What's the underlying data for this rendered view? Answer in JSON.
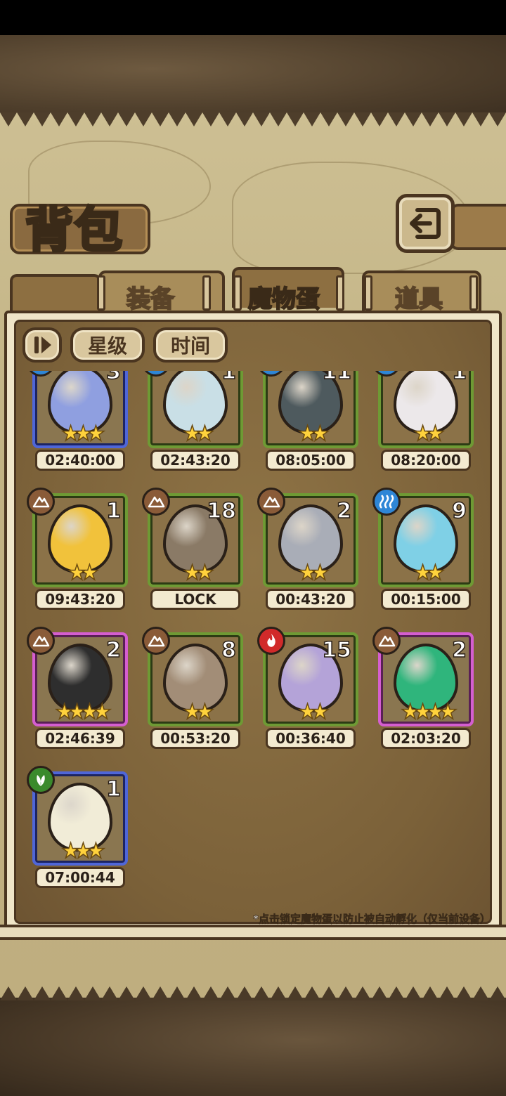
{
  "header": {
    "title": "背包",
    "back_button_icon": "return-arrow-icon"
  },
  "tabs": [
    {
      "label": "装备",
      "active": false
    },
    {
      "label": "魔物蛋",
      "active": true
    },
    {
      "label": "道具",
      "active": false
    }
  ],
  "sort": {
    "toggle_icon": "sort-toggle-icon",
    "star_label": "星级",
    "time_label": "时间"
  },
  "eggs": [
    {
      "count": "3",
      "stars": "★★★",
      "timer": "02:40:00",
      "rarity": "blue",
      "element": "water",
      "color": "#8f9fe0"
    },
    {
      "count": "1",
      "stars": "★★",
      "timer": "02:43:20",
      "rarity": "green",
      "element": "water",
      "color": "#c9dfe6"
    },
    {
      "count": "11",
      "stars": "★★",
      "timer": "08:05:00",
      "rarity": "green",
      "element": "water",
      "color": "#4e5a5e"
    },
    {
      "count": "1",
      "stars": "★★",
      "timer": "08:20:00",
      "rarity": "green",
      "element": "water",
      "color": "#ece8ea"
    },
    {
      "count": "1",
      "stars": "★★",
      "timer": "09:43:20",
      "rarity": "green",
      "element": "earth",
      "color": "#f1c23b"
    },
    {
      "count": "18",
      "stars": "★★",
      "timer": "LOCK",
      "rarity": "green",
      "element": "earth",
      "color": "#8a7a66"
    },
    {
      "count": "2",
      "stars": "★★",
      "timer": "00:43:20",
      "rarity": "green",
      "element": "earth",
      "color": "#a9adb7"
    },
    {
      "count": "9",
      "stars": "★★",
      "timer": "00:15:00",
      "rarity": "green",
      "element": "water",
      "color": "#7fd0e6"
    },
    {
      "count": "2",
      "stars": "★★★★",
      "timer": "02:46:39",
      "rarity": "purple",
      "element": "earth",
      "color": "#2e2e2e"
    },
    {
      "count": "8",
      "stars": "★★",
      "timer": "00:53:20",
      "rarity": "green",
      "element": "earth",
      "color": "#a28d77"
    },
    {
      "count": "15",
      "stars": "★★",
      "timer": "00:36:40",
      "rarity": "green",
      "element": "fire",
      "color": "#b4a3d8"
    },
    {
      "count": "2",
      "stars": "★★★★",
      "timer": "02:03:20",
      "rarity": "purple",
      "element": "earth",
      "color": "#2fb57c"
    },
    {
      "count": "1",
      "stars": "★★★",
      "timer": "07:00:44",
      "rarity": "blue",
      "element": "grass",
      "color": "#f1ecd7"
    }
  ],
  "hint": "*点击锁定魔物蛋以防止被自动孵化（仅当前设备）"
}
